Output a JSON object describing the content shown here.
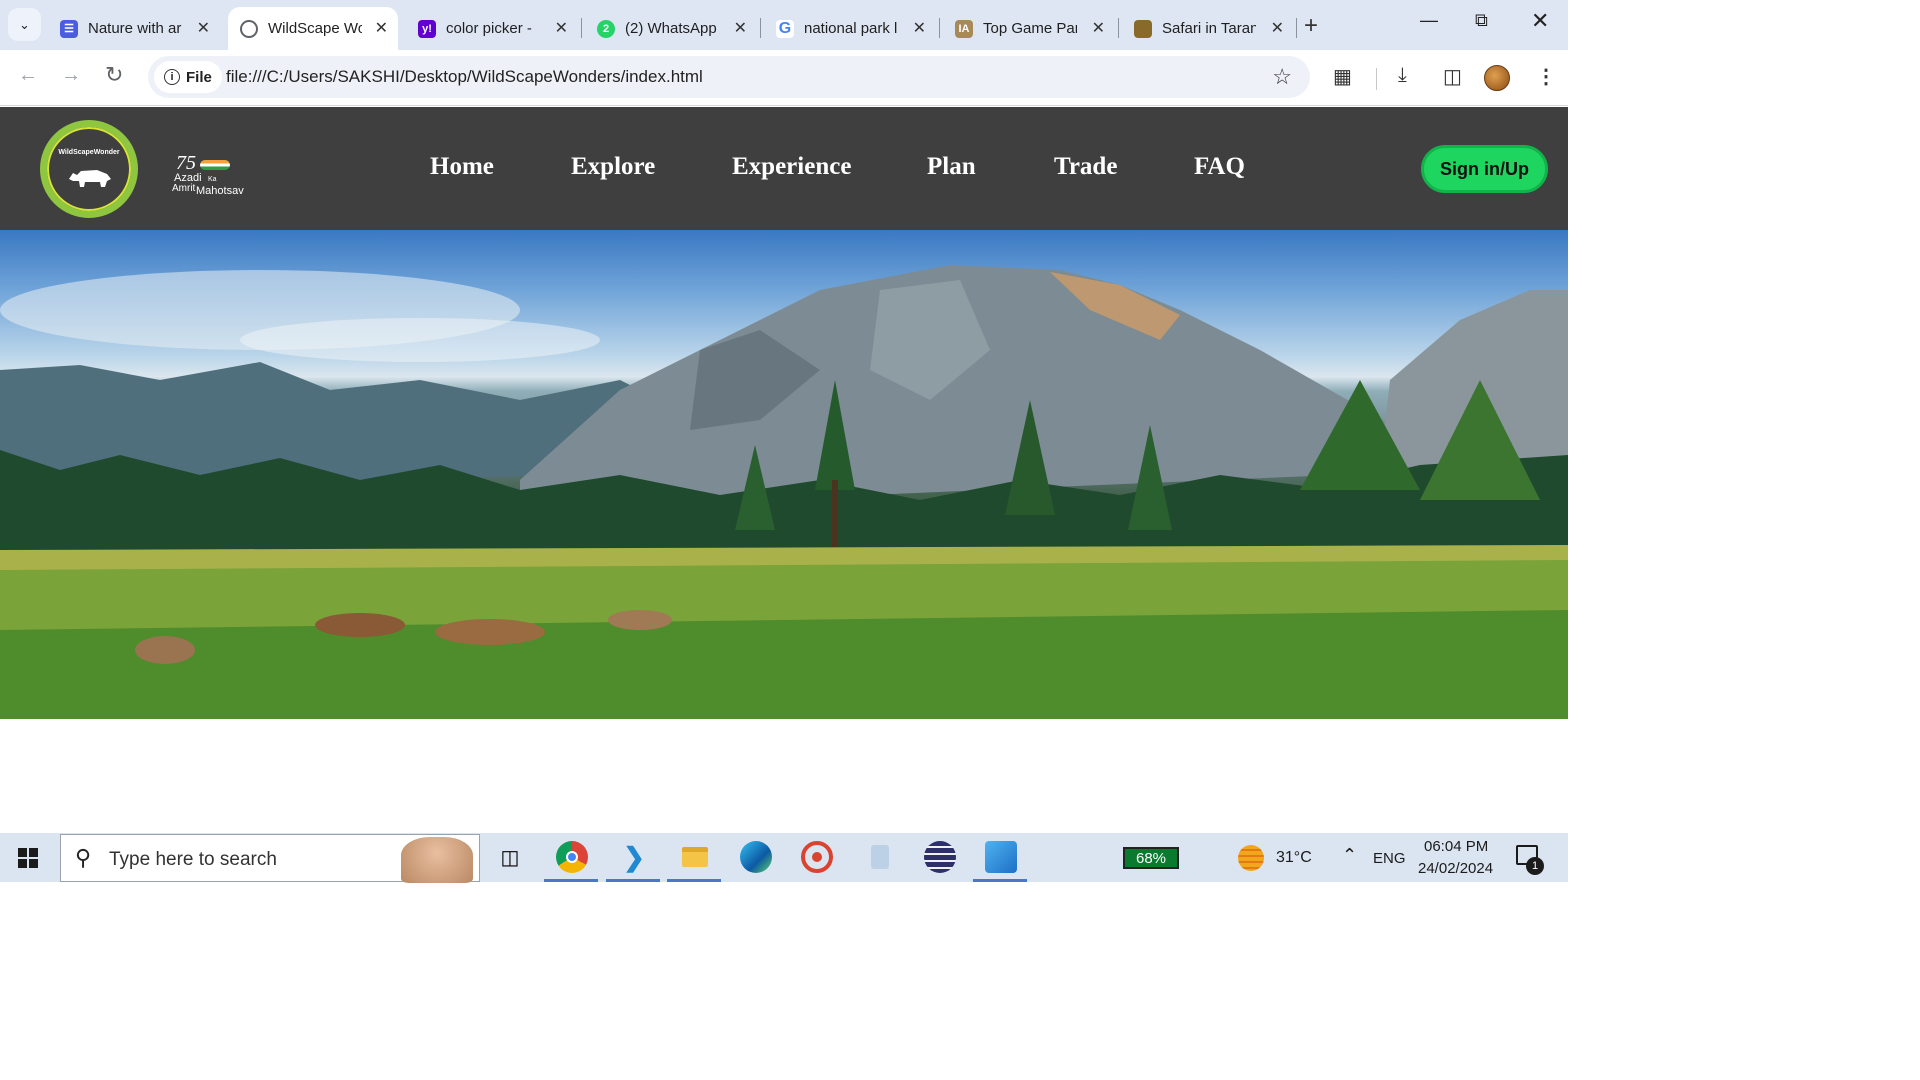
{
  "browser": {
    "tabs": [
      {
        "title": "Nature with ar",
        "favicon": "forms-icon",
        "favicon_color": "#4a5de0",
        "active": false
      },
      {
        "title": "WildScape Wo",
        "favicon": "globe-icon",
        "favicon_color": "#5f6368",
        "active": true
      },
      {
        "title": "color picker - ",
        "favicon": "yahoo-icon",
        "favicon_color": "#6001d2",
        "active": false
      },
      {
        "title": "(2) WhatsApp",
        "favicon": "whatsapp-icon",
        "favicon_color": "#25d366",
        "active": false
      },
      {
        "title": "national park l",
        "favicon": "google-icon",
        "favicon_color": "#4285f4",
        "active": false
      },
      {
        "title": "Top Game Par",
        "favicon": "ia-icon",
        "favicon_color": "#a88a5a",
        "active": false
      },
      {
        "title": "Safari in Taran",
        "favicon": "tiger-icon",
        "favicon_color": "#8a6a2a",
        "active": false
      }
    ],
    "whatsapp_badge": "2",
    "yahoo_letter": "y!",
    "google_letter": "G",
    "ia_letter": "IA",
    "site_chip": "File",
    "url": "file:///C:/Users/SAKSHI/Desktop/WildScapeWonders/index.html"
  },
  "site": {
    "logo_text": "WildScapeWonder",
    "azadi": {
      "n75": "75",
      "azadi": "Azadi",
      "ka": "Ka",
      "amrit": "Amrit",
      "mahotsav": "Mahotsav"
    },
    "nav": [
      "Home",
      "Explore",
      "Experience",
      "Plan",
      "Trade",
      "FAQ"
    ],
    "signin_label": "Sign in/Up",
    "accent_color": "#1ed65f",
    "nav_bg": "#3f3f3f"
  },
  "taskbar": {
    "search_placeholder": "Type here to search",
    "battery": "68%",
    "temperature": "31°C",
    "language": "ENG",
    "time": "06:04 PM",
    "date": "24/02/2024",
    "notification_count": "1"
  }
}
